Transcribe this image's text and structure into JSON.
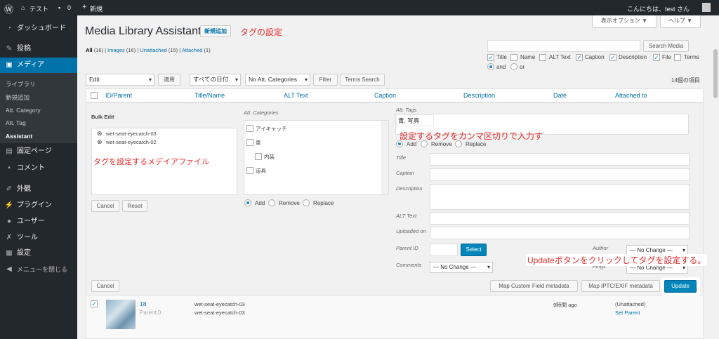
{
  "adminbar": {
    "site": "テスト",
    "comments": "0",
    "new": "新規",
    "greeting": "こんにちは、test さん"
  },
  "sidebar": {
    "dashboard": "ダッシュボード",
    "posts": "投稿",
    "media": "メディア",
    "media_sub": [
      "ライブラリ",
      "新規追加",
      "Att. Category",
      "Att. Tag",
      "Assistant"
    ],
    "pages": "固定ページ",
    "comments": "コメント",
    "appearance": "外観",
    "plugins": "プラグイン",
    "users": "ユーザー",
    "tools": "ツール",
    "settings": "設定",
    "collapse": "メニューを閉じる"
  },
  "header": {
    "title": "Media Library Assistant",
    "add_new": "新規追加",
    "screen_options": "表示オプション ▼",
    "help": "ヘルプ ▼"
  },
  "filters": {
    "all": "All",
    "all_count": "(16)",
    "images": "Images",
    "images_count": "(16)",
    "unattached": "Unattached",
    "unattached_count": "(15)",
    "attached": "Attached",
    "attached_count": "(1)"
  },
  "search": {
    "button": "Search Media",
    "fields": [
      "Title",
      "Name",
      "ALT Text",
      "Caption",
      "Description",
      "File",
      "Terms"
    ],
    "checked": [
      true,
      false,
      false,
      true,
      true,
      true,
      false
    ],
    "and": "and",
    "or": "or"
  },
  "toolbar": {
    "bulk_action": "Edit",
    "apply": "適用",
    "dates": "すべての日付",
    "categories": "No Att. Categories",
    "filter": "Filter",
    "terms_search": "Terms Search",
    "count": "14個の項目"
  },
  "columns": [
    "ID/Parent",
    "Title/Name",
    "ALT Text",
    "Caption",
    "Description",
    "Date",
    "Attached to"
  ],
  "bulk": {
    "title": "Bulk Edit",
    "files": [
      "wet-seat-eyecatch-03",
      "wet-seat-eyecatch-02"
    ],
    "cancel": "Cancel",
    "reset": "Reset",
    "cat_label": "Att. Categories",
    "categories": [
      "アイキャッチ",
      "車",
      "内装",
      "道具"
    ],
    "add": "Add",
    "remove": "Remove",
    "replace": "Replace",
    "tags_label": "Att. Tags",
    "tags_value": "青, 写真",
    "labels": {
      "title": "Title",
      "caption": "Caption",
      "description": "Description",
      "alt": "ALT Text",
      "uploaded": "Uploaded on",
      "parent": "Parent ID",
      "comments": "Comments",
      "author": "Author",
      "pings": "Pings"
    },
    "select": "Select",
    "no_change": "— No Change —",
    "cancel2": "Cancel",
    "map_custom": "Map Custom Field metadata",
    "map_iptc": "Map IPTC/EXIF metadata",
    "update": "Update"
  },
  "row": {
    "id": "18",
    "parent": "Parent:0",
    "title": "wet-seat-eyecatch-03",
    "name": "wet-seat-eyecatch-03",
    "date": "9時間 ago",
    "attached": "(Unattached)",
    "set_parent": "Set Parent"
  },
  "annotations": {
    "tag_setting": "タグの設定",
    "files_note": "タグを設定するメデイアファイル",
    "tags_note": "設定するタグをカンマ区切りで入力す",
    "update_note": "Updateボタンをクリックしてタグを設定する。"
  }
}
